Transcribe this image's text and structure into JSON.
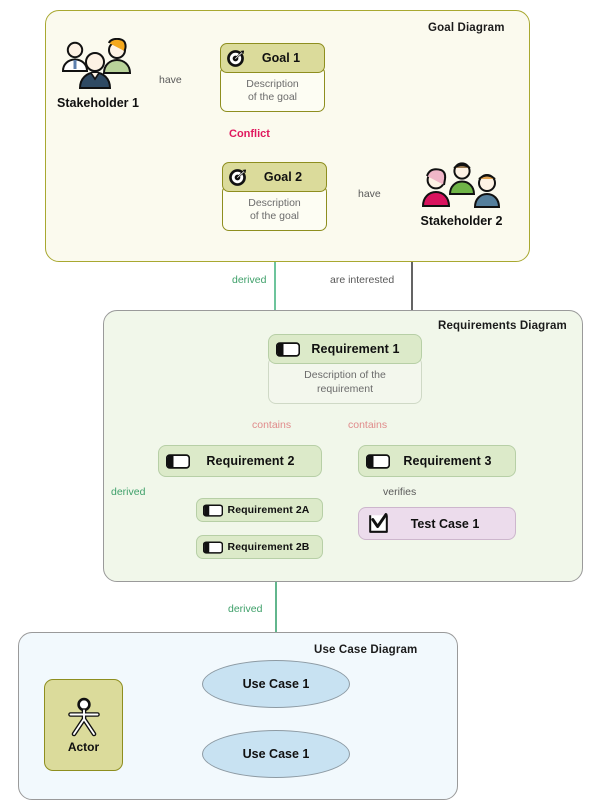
{
  "title": "Requirements traceability: Goal, Requirements and Use Case diagrams",
  "colors": {
    "goal_panel_bg": "#fbfaee",
    "goal_panel_border": "#a8a830",
    "goal_header_bg": "#dbdb9b",
    "goal_header_border": "#8e8e1f",
    "req_panel_bg": "#f1f7ea",
    "req_panel_border": "#9a9a9a",
    "req_header_bg": "#dceac9",
    "usecase_panel_bg": "#f2f9fd",
    "usecase_fill": "#c8e2f2",
    "testcase_fill": "#ecdcec",
    "conflict": "#e0185e",
    "derived_green": "#2e9e67",
    "contains_pink": "#e08b8b",
    "arrow_black": "#111111"
  },
  "panels": [
    {
      "id": "goal",
      "title": "Goal Diagram"
    },
    {
      "id": "requirements",
      "title": "Requirements Diagram"
    },
    {
      "id": "usecase",
      "title": "Use Case Diagram"
    }
  ],
  "goal_diagram": {
    "title": "Goal Diagram",
    "stakeholder": {
      "label": "Stakeholder 1",
      "icon": "people-group-icon"
    },
    "goals": [
      {
        "icon": "goal-target-icon",
        "title": "Goal 1",
        "description": "Description\nof the goal"
      },
      {
        "icon": "goal-target-icon",
        "title": "Goal 2",
        "description": "Description\nof the goal"
      }
    ],
    "goal1_title": "Goal 1",
    "goal1_desc_line1": "Description",
    "goal1_desc_line2": "of the goal",
    "goal2_title": "Goal 2",
    "goal2_desc_line1": "Description",
    "goal2_desc_line2": "of the goal",
    "edges": [
      {
        "label": "have",
        "from": "Stakeholder 1",
        "to": "Goal 1",
        "style": "solid-black-arrow"
      },
      {
        "label": "Conflict",
        "from": "Goal 1",
        "to": "Goal 2",
        "style": "double-headed-pink"
      },
      {
        "label": "have",
        "from": "Stakeholder 2",
        "to": "Goal 2",
        "style": "solid-black-arrow"
      }
    ],
    "have_label_1": "have",
    "conflict_label": "Conflict",
    "have_label_2": "have",
    "stakeholder2": {
      "label": "Stakeholder 2",
      "icon": "people-group-icon"
    }
  },
  "requirements_diagram": {
    "title": "Requirements Diagram",
    "req1": {
      "icon": "requirement-icon",
      "title": "Requirement 1",
      "desc_line1": "Description of the",
      "desc_line2": "requirement"
    },
    "req2": {
      "icon": "requirement-icon",
      "title": "Requirement 2"
    },
    "req3": {
      "icon": "requirement-icon",
      "title": "Requirement 3"
    },
    "req2a": {
      "icon": "requirement-icon",
      "title": "Requirement 2A"
    },
    "req2b": {
      "icon": "requirement-icon",
      "title": "Requirement 2B"
    },
    "testcase": {
      "icon": "test-case-icon",
      "title": "Test Case 1"
    },
    "contains_label_left": "contains",
    "contains_label_right": "contains",
    "derived_label": "derived",
    "verifies_label": "verifies",
    "edges": [
      {
        "label": "contains",
        "from": "Requirement 1",
        "to": "Requirement 2",
        "style": "composition-pink"
      },
      {
        "label": "contains",
        "from": "Requirement 1",
        "to": "Requirement 3",
        "style": "composition-pink"
      },
      {
        "label": "derived",
        "from": "Requirement 2A",
        "to": "Requirement 2",
        "style": "green-arrow"
      },
      {
        "label": "derived",
        "from": "Requirement 2B",
        "to": "Requirement 2",
        "style": "green-arrow"
      },
      {
        "label": "verifies",
        "from": "Test Case 1",
        "to": "Requirement 3",
        "style": "solid-black-arrow"
      }
    ]
  },
  "usecase_diagram": {
    "title": "Use Case Diagram",
    "actor": {
      "icon": "actor-stickman-icon",
      "label": "Actor"
    },
    "usecase1": {
      "title": "Use Case 1"
    },
    "usecase2": {
      "title": "Use Case 1"
    },
    "edges": [
      {
        "from": "Actor",
        "to": "Use Case 1",
        "style": "double-headed-black"
      },
      {
        "from": "Actor",
        "to": "Use Case 1",
        "style": "double-headed-black"
      }
    ]
  },
  "cross_edges": {
    "derived_goal": "derived",
    "are_interested": "are interested",
    "derived_usecase": "derived"
  }
}
